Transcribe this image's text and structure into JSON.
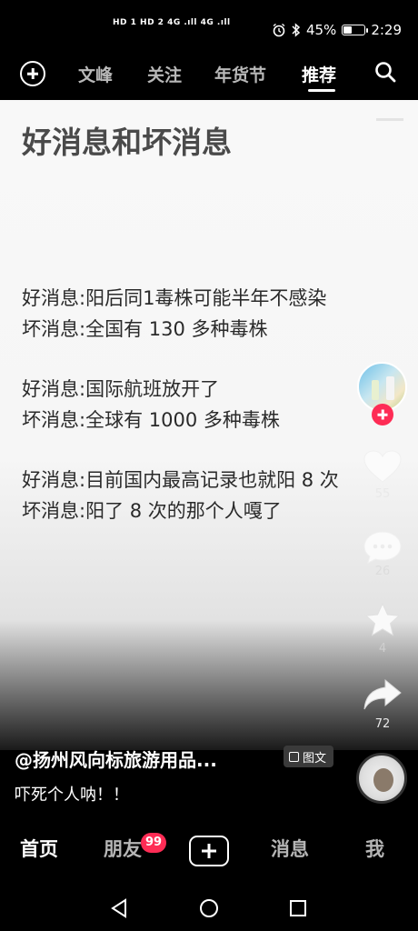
{
  "status_bar": {
    "network_left": "HD 1 HD 2  4G .ıll 4G .ıll",
    "battery_text": "45%",
    "battery_level": 0.45,
    "time": "2:29",
    "icons": [
      "alarm-icon",
      "bluetooth-icon",
      "battery-icon"
    ]
  },
  "top_nav": {
    "tabs": [
      {
        "label": "文峰",
        "active": false
      },
      {
        "label": "关注",
        "active": false
      },
      {
        "label": "年货节",
        "active": false
      },
      {
        "label": "推荐",
        "active": true
      }
    ],
    "icons": [
      "add-circle-icon",
      "search-icon"
    ]
  },
  "post": {
    "title": "好消息和坏消息",
    "lines": [
      "好消息:阳后同1毒株可能半年不感染",
      "坏消息:全国有 130 多种毒株",
      "好消息:国际航班放开了",
      "坏消息:全球有 1000 多种毒株",
      "好消息:目前国内最高记录也就阳 8 次",
      "坏消息:阳了 8 次的那个人嘎了"
    ]
  },
  "actions": {
    "likes": "55",
    "comments": "26",
    "favorites": "4",
    "shares": "72"
  },
  "caption": {
    "author": "@扬州风向标旅游用品...",
    "badge": "图文",
    "text": "吓死个人呐！！"
  },
  "tab_bar": {
    "tabs": [
      {
        "label": "首页",
        "active": true
      },
      {
        "label": "朋友",
        "active": false
      },
      {
        "label": "消息",
        "active": false
      },
      {
        "label": "我",
        "active": false
      }
    ],
    "friends_badge": "99"
  },
  "colors": {
    "accent": "#fe2c55",
    "background": "#000000",
    "content_bg": "#f7f7f7"
  }
}
